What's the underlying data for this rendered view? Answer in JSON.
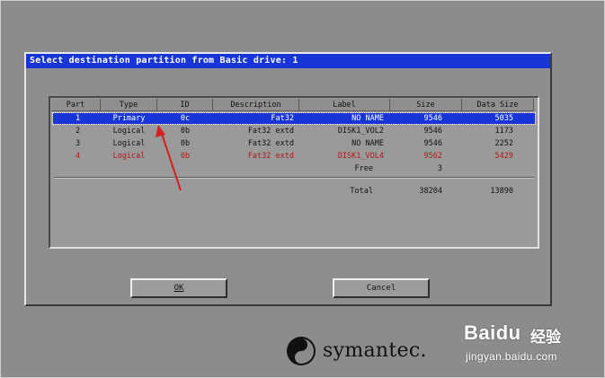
{
  "dialog": {
    "title": "Select destination partition from Basic drive: 1"
  },
  "table": {
    "headers": [
      "Part",
      "Type",
      "ID",
      "Description",
      "Label",
      "Size",
      "Data Size"
    ],
    "rows": [
      {
        "part": "1",
        "type": "Primary",
        "id": "0c",
        "description": "Fat32",
        "label": "NO NAME",
        "size": "9546",
        "data_size": "5035"
      },
      {
        "part": "2",
        "type": "Logical",
        "id": "0b",
        "description": "Fat32 extd",
        "label": "DISK1_VOL2",
        "size": "9546",
        "data_size": "1173"
      },
      {
        "part": "3",
        "type": "Logical",
        "id": "0b",
        "description": "Fat32 extd",
        "label": "NO NAME",
        "size": "9546",
        "data_size": "2252"
      },
      {
        "part": "4",
        "type": "Logical",
        "id": "0b",
        "description": "Fat32 extd",
        "label": "DISK1_VOL4",
        "size": "9562",
        "data_size": "5429"
      }
    ],
    "free": {
      "label": "Free",
      "size": "3"
    },
    "total": {
      "label": "Total",
      "size": "38204",
      "data_size": "13890"
    }
  },
  "buttons": {
    "ok_label": "OK",
    "cancel_label": "Cancel"
  },
  "branding": {
    "vendor": "symantec."
  },
  "watermark": {
    "brand": "Baidu",
    "cn": "经验",
    "url": "jingyan.baidu.com"
  },
  "colors": {
    "selection": "#1836d8",
    "dialog_bg": "#8e8e8e",
    "warning_row": "#b01818",
    "annotation_arrow": "#d42020"
  }
}
